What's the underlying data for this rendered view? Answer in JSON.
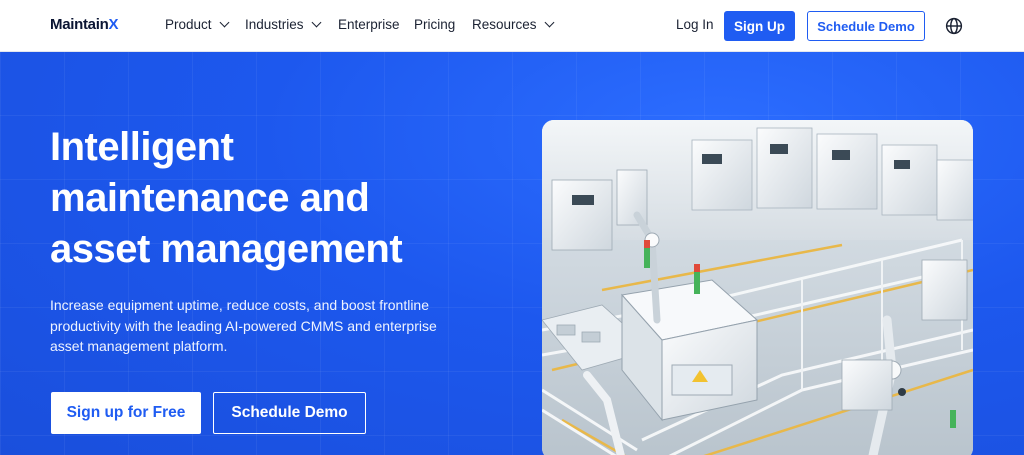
{
  "brand": {
    "name_main": "Maintain",
    "name_accent": "X"
  },
  "nav": {
    "items": [
      {
        "label": "Product",
        "dropdown": true
      },
      {
        "label": "Industries",
        "dropdown": true
      },
      {
        "label": "Enterprise",
        "dropdown": false
      },
      {
        "label": "Pricing",
        "dropdown": false
      },
      {
        "label": "Resources",
        "dropdown": true
      }
    ],
    "login_label": "Log In",
    "signup_label": "Sign Up",
    "demo_label": "Schedule Demo",
    "language_icon": "globe-icon"
  },
  "hero": {
    "title_line1": "Intelligent",
    "title_line2": "maintenance and",
    "title_line3": "asset management",
    "subtitle": "Increase equipment uptime, reduce costs, and boost frontline productivity with the leading AI-powered CMMS and enterprise asset management platform.",
    "primary_cta": "Sign up for Free",
    "secondary_cta": "Schedule Demo",
    "image": "factory-automation-illustration"
  },
  "colors": {
    "brand_blue": "#1f5cf2",
    "hero_bg": "#1d58ee",
    "nav_text": "#1b2233",
    "white": "#ffffff"
  }
}
